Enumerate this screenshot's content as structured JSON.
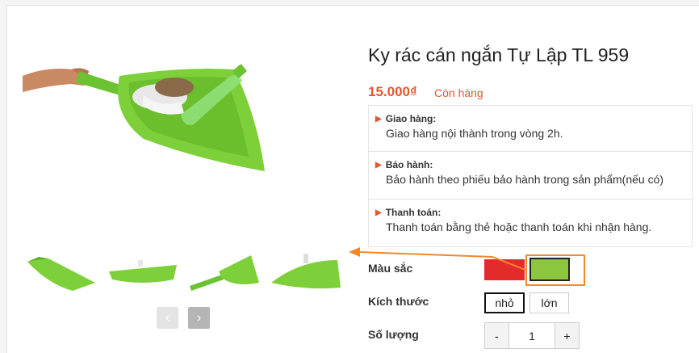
{
  "product": {
    "title": "Ky rác cán ngắn Tự Lập TL 959",
    "price": "15.000₫",
    "stock_status": "Còn hàng"
  },
  "info": [
    {
      "heading": "Giao hàng:",
      "text": "Giao hàng nội thành trong vòng 2h."
    },
    {
      "heading": "Bảo hành:",
      "text": "Bảo hành theo phiếu bảo hành trong sản phẩm(nếu có)"
    },
    {
      "heading": "Thanh toán:",
      "text": "Thanh toán bằng thẻ hoặc thanh toán khi nhận hàng."
    }
  ],
  "options": {
    "color_label": "Màu sắc",
    "colors": [
      {
        "name": "red",
        "hex": "#e32b2b"
      },
      {
        "name": "green",
        "hex": "#8cc63f",
        "selected": true
      }
    ],
    "size_label": "Kích thước",
    "sizes": [
      {
        "label": "nhỏ",
        "selected": true
      },
      {
        "label": "lớn",
        "selected": false
      }
    ],
    "quantity_label": "Số lượng",
    "quantity_value": "1",
    "minus": "-",
    "plus": "+"
  },
  "gallery": {
    "prev_icon": "chevron-left-icon",
    "next_icon": "chevron-right-icon",
    "prev_glyph": "‹",
    "next_glyph": "›"
  },
  "colors": {
    "accent": "#e4572e",
    "annotation": "#f0882a",
    "product_green": "#7ed03a"
  }
}
